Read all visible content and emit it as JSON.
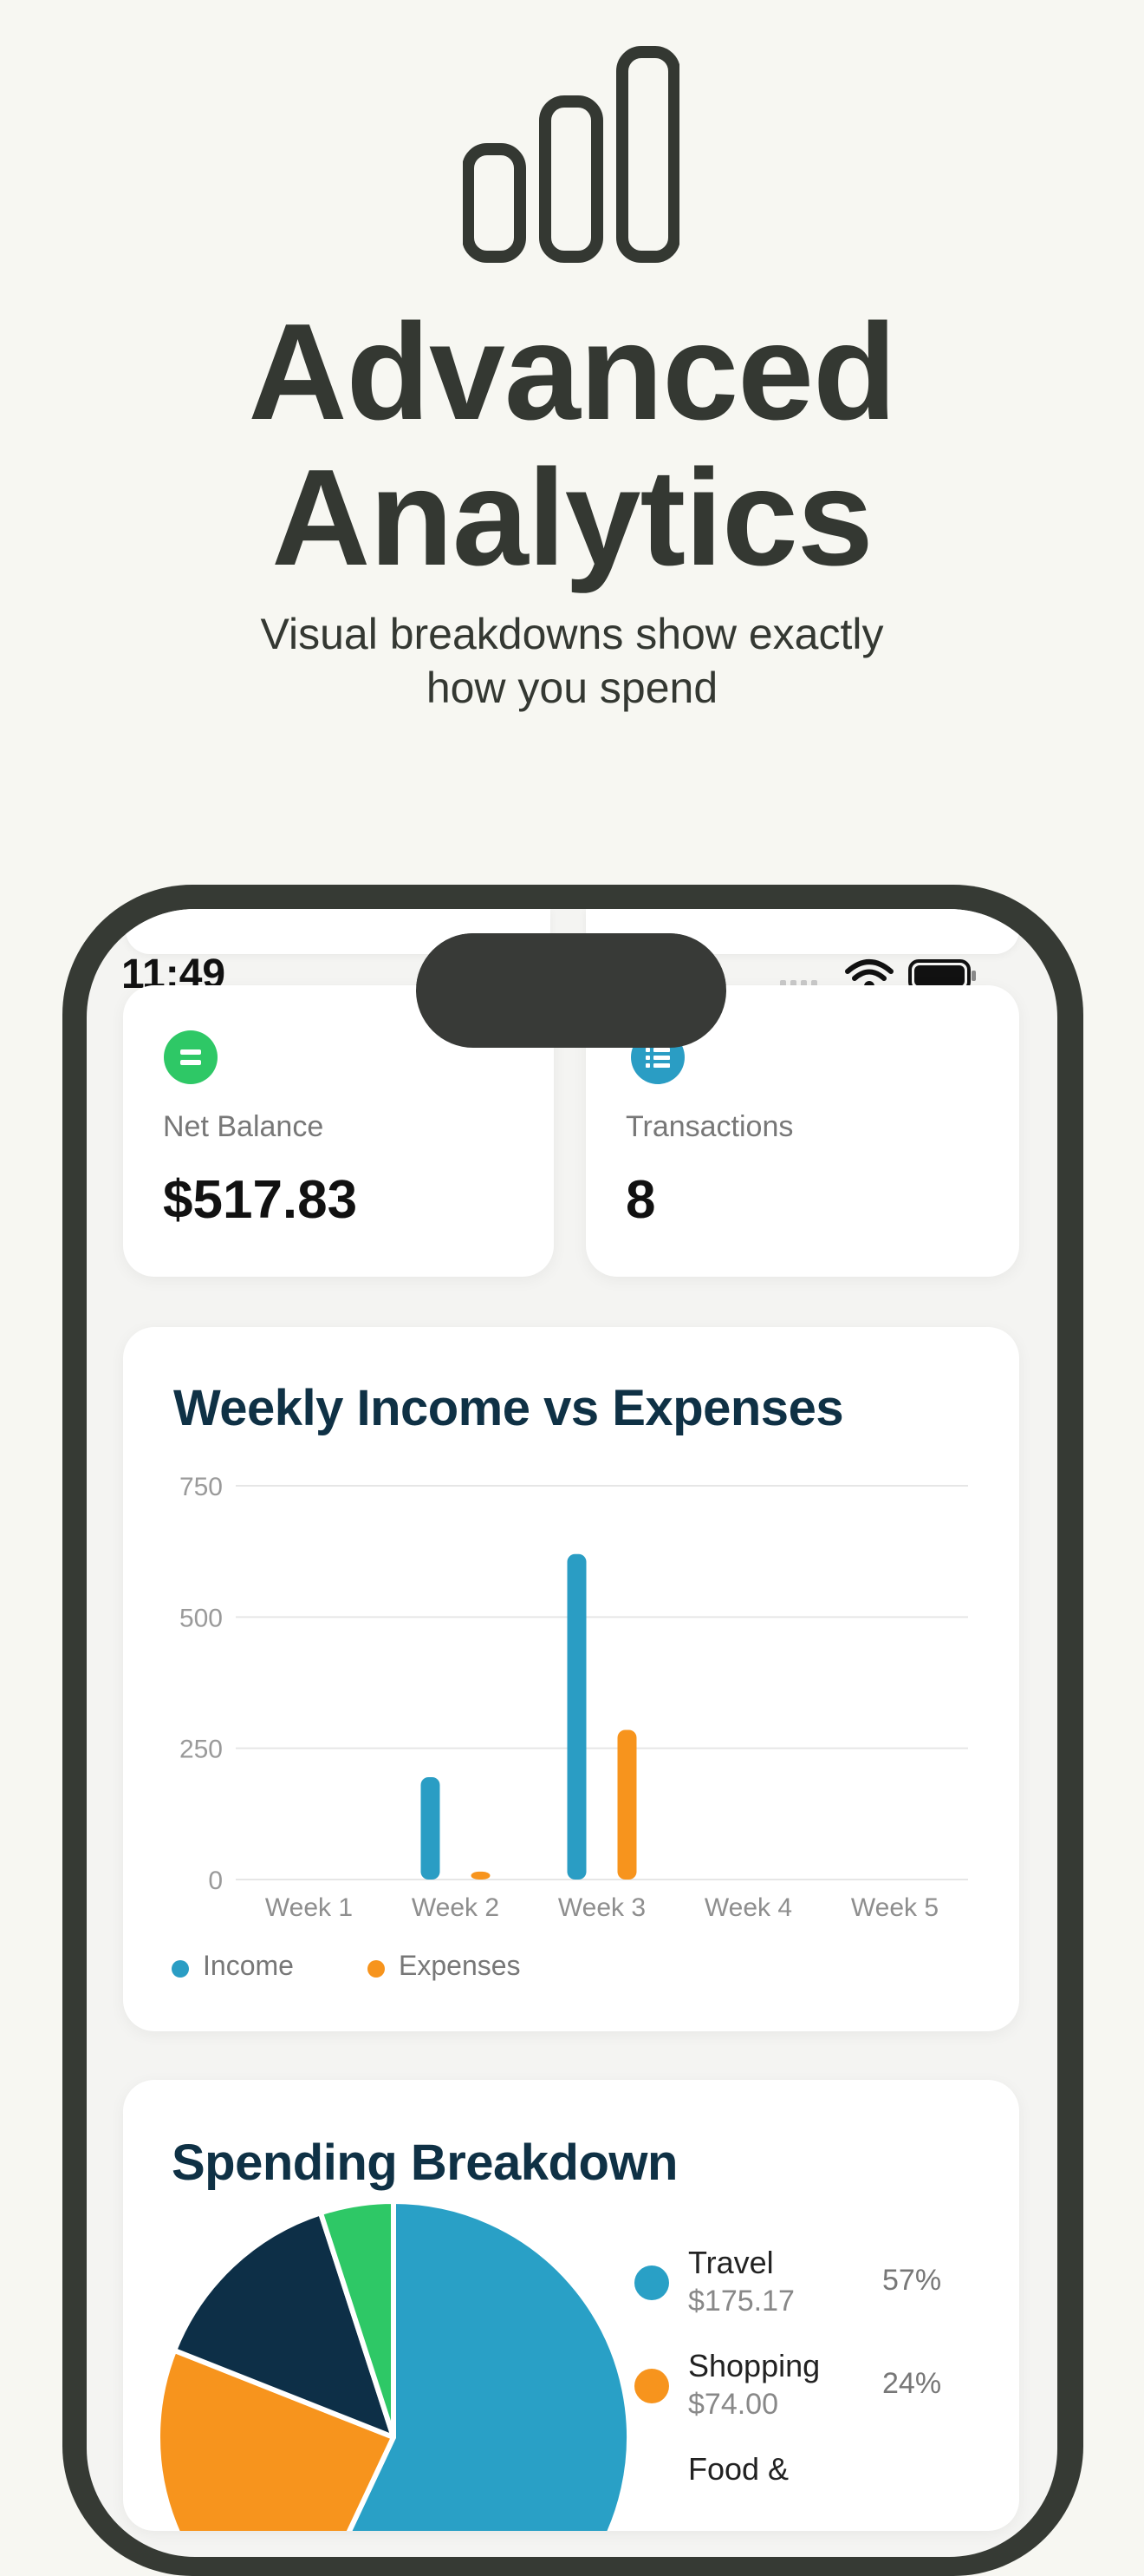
{
  "hero": {
    "icon": "bar-chart-icon",
    "title_line1": "Advanced",
    "title_line2": "Analytics",
    "subtitle_line1": "Visual breakdowns show exactly",
    "subtitle_line2": "how you spend"
  },
  "status_bar": {
    "time": "11:49",
    "icons": [
      "cellular-signal-icon",
      "wifi-icon",
      "battery-icon"
    ]
  },
  "stats": [
    {
      "icon": "equals-icon",
      "icon_color": "#2ec866",
      "label": "Net Balance",
      "value": "$517.83"
    },
    {
      "icon": "list-icon",
      "icon_color": "#2a9dc4",
      "label": "Transactions",
      "value": "8"
    }
  ],
  "weekly_chart": {
    "title": "Weekly Income vs Expenses",
    "legend": [
      {
        "name": "Income",
        "color": "#2a9dc4"
      },
      {
        "name": "Expenses",
        "color": "#f7941d"
      }
    ]
  },
  "spending": {
    "title": "Spending Breakdown",
    "items": [
      {
        "name": "Travel",
        "amount": "$175.17",
        "percent": "57%",
        "color": "#29a0c6"
      },
      {
        "name": "Shopping",
        "amount": "$74.00",
        "percent": "24%",
        "color": "#f7941d"
      },
      {
        "name": "Food &",
        "amount": "",
        "percent": "",
        "color": "#0d2f47"
      }
    ]
  },
  "chart_data": [
    {
      "type": "bar",
      "title": "Weekly Income vs Expenses",
      "categories": [
        "Week 1",
        "Week 2",
        "Week 3",
        "Week 4",
        "Week 5"
      ],
      "series": [
        {
          "name": "Income",
          "color": "#2a9dc4",
          "values": [
            0,
            195,
            620,
            0,
            0
          ]
        },
        {
          "name": "Expenses",
          "color": "#f7941d",
          "values": [
            0,
            15,
            285,
            0,
            0
          ]
        }
      ],
      "ylim": [
        0,
        750
      ],
      "yticks": [
        0,
        250,
        500,
        750
      ],
      "grid": true,
      "legend": "bottom-left"
    },
    {
      "type": "pie",
      "title": "Spending Breakdown",
      "slices": [
        {
          "label": "Travel",
          "value": 57,
          "color": "#29a0c6"
        },
        {
          "label": "Shopping",
          "value": 24,
          "color": "#f7941d"
        },
        {
          "label": "Food &",
          "value": 14,
          "color": "#0d2f47"
        },
        {
          "label": "",
          "value": 5,
          "color": "#2ec866"
        }
      ]
    }
  ]
}
